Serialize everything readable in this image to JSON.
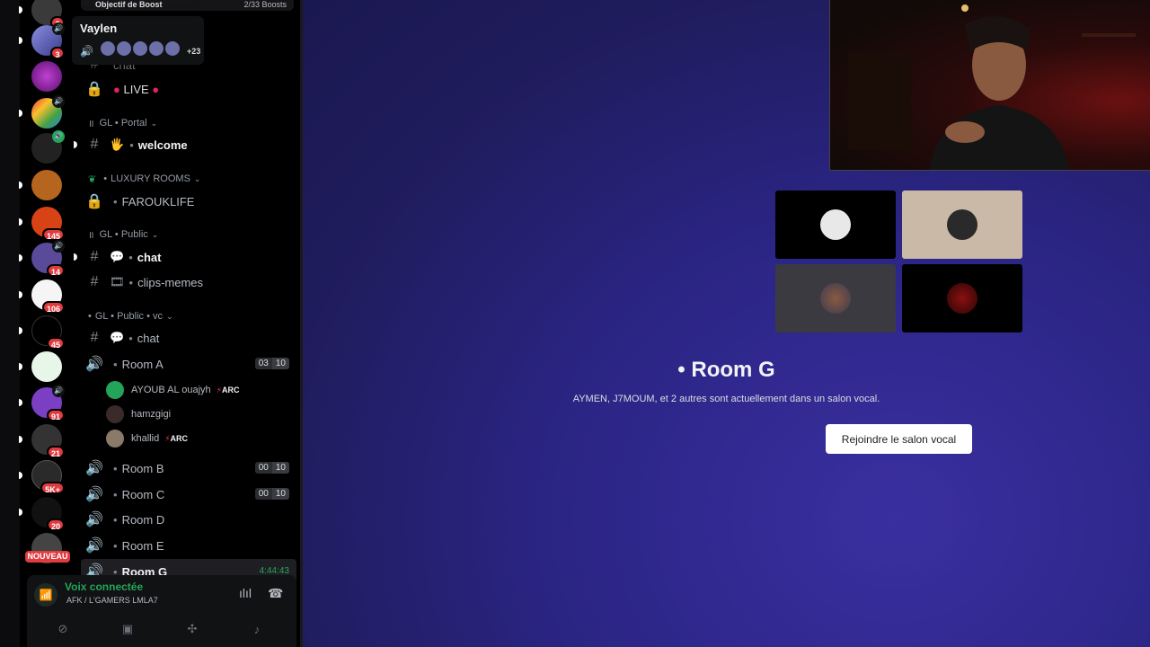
{
  "tooltip": {
    "name": "Vaylen",
    "more": "+23"
  },
  "boost": {
    "label": "Objectif de Boost",
    "count": "2/33 Boosts"
  },
  "server_badges": [
    "3",
    "3",
    "145",
    "14",
    "106",
    "45",
    "91",
    "21",
    "5K+",
    "20"
  ],
  "server_new_label": "NOUVEAU",
  "channels": {
    "chat_top": "chat",
    "live": "LIVE",
    "cat_portal": "GL • Portal",
    "welcome": "welcome",
    "cat_luxury": "LUXURY ROOMS",
    "farouklife": "FAROUKLIFE",
    "cat_public": "GL • Public",
    "chat": "chat",
    "clips": "clips-memes",
    "cat_public_vc": "GL • Public • vc",
    "vc_chat": "chat",
    "room_a": "Room A",
    "room_a_counts": [
      "03",
      "10"
    ],
    "users": [
      {
        "name": "AYOUB AL ouajyh",
        "tag": "ARC"
      },
      {
        "name": "hamzgigi",
        "tag": ""
      },
      {
        "name": "khallid",
        "tag": "ARC"
      }
    ],
    "room_b": "Room B",
    "room_b_counts": [
      "00",
      "10"
    ],
    "room_c": "Room C",
    "room_c_counts": [
      "00",
      "10"
    ],
    "room_d": "Room D",
    "room_e": "Room E",
    "room_g": "Room G",
    "room_g_time": "4:44:43"
  },
  "voice_panel": {
    "status": "Voix connectée",
    "location": "AFK / L'GAMERS LMLA7"
  },
  "stage": {
    "title": "Room G",
    "subtitle": "AYMEN, J7MOUM, et 2 autres sont actuellement dans un salon vocal.",
    "join_label": "Rejoindre le salon vocal"
  },
  "colors": {
    "stage_bg": "#2b2585",
    "connected_green": "#23a559",
    "badge_red": "#e03b3f"
  }
}
